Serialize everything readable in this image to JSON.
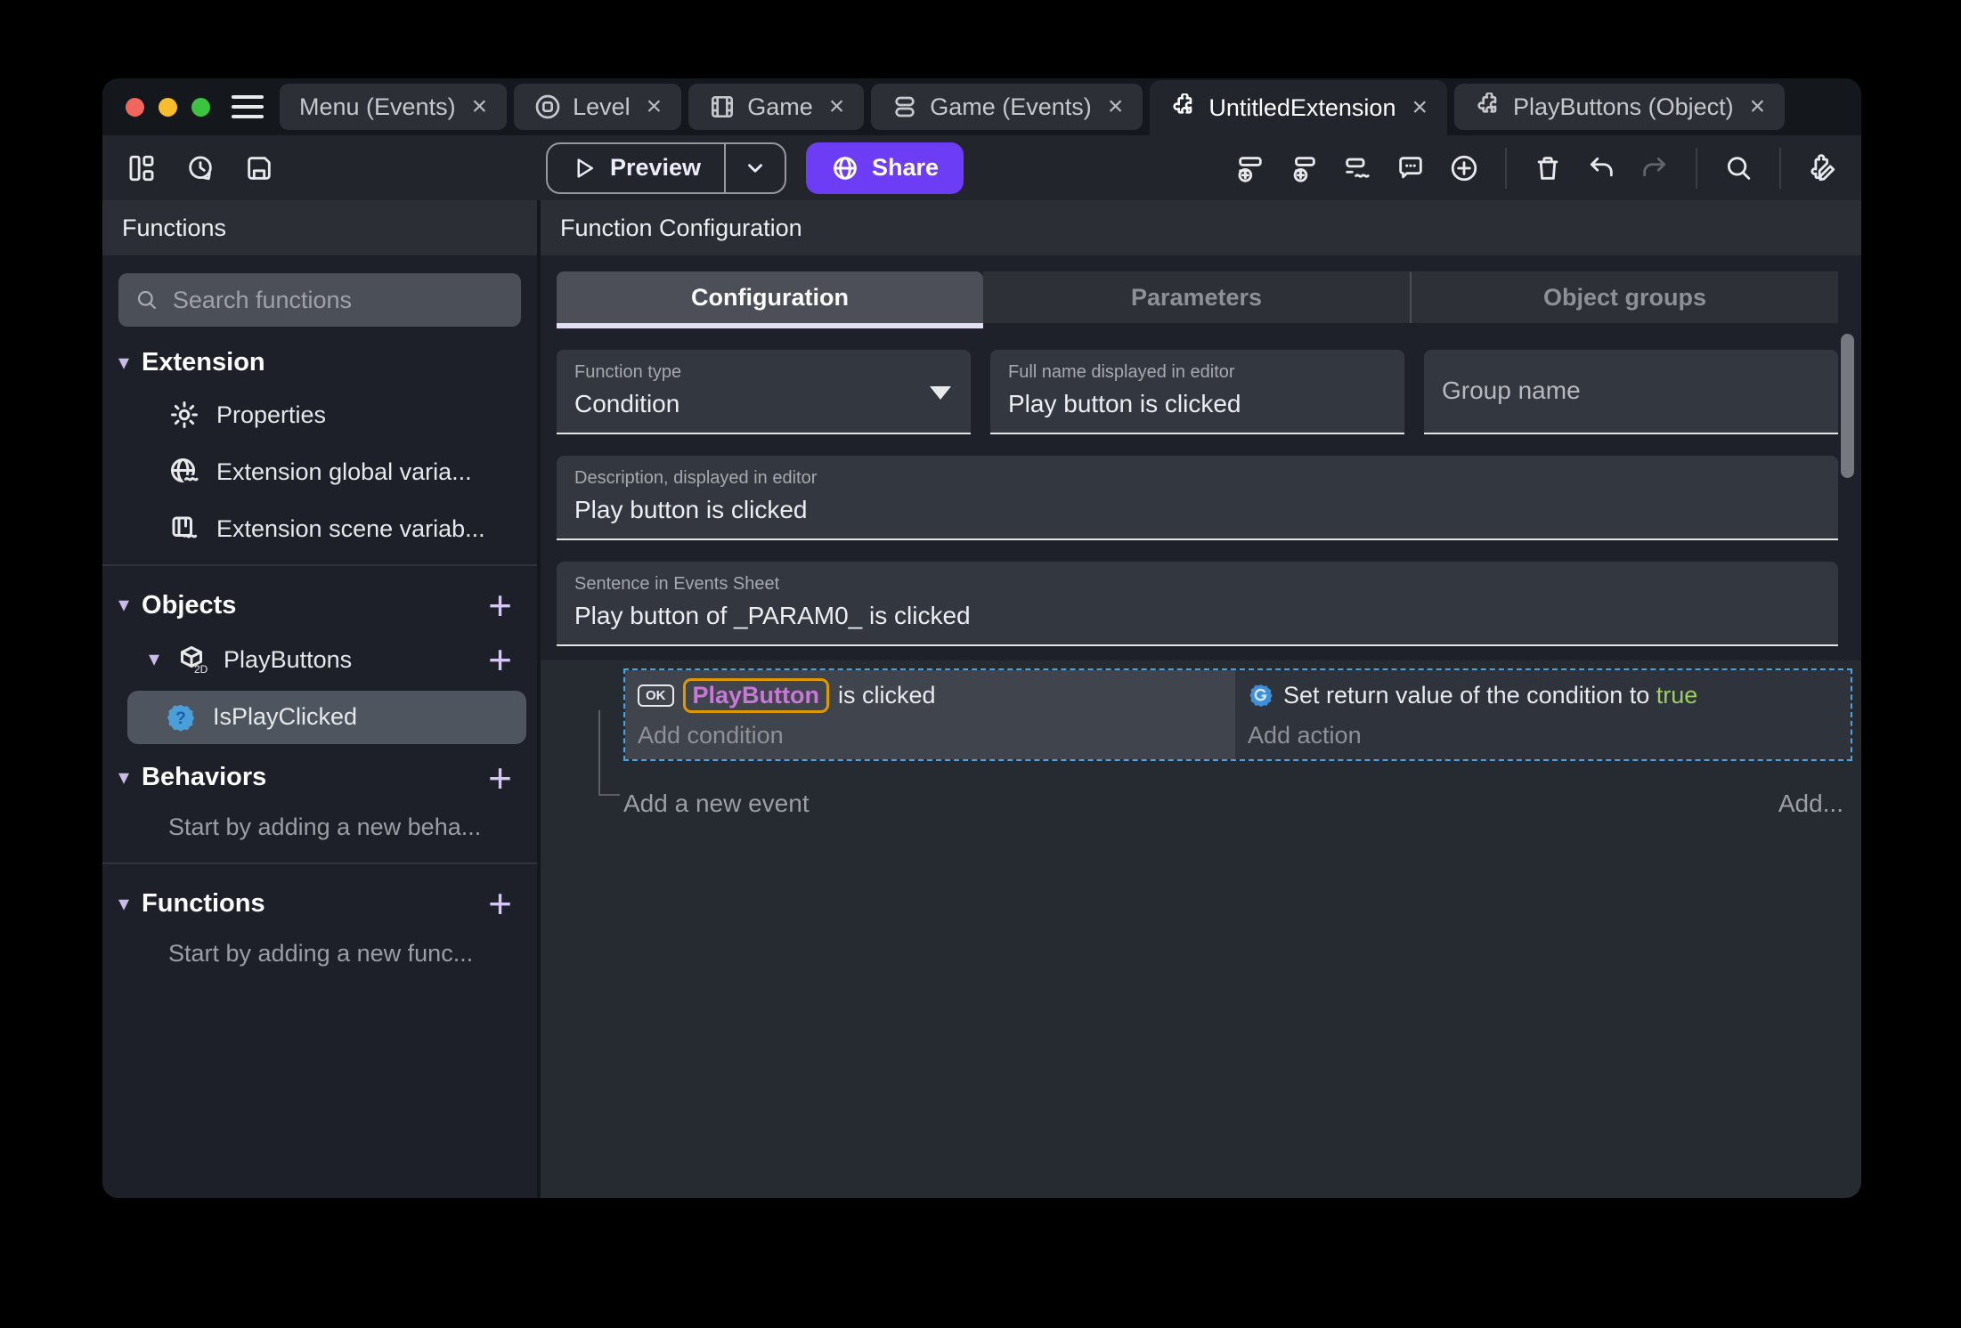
{
  "window": {
    "tabs": [
      {
        "label": "Menu (Events)",
        "close": "×"
      },
      {
        "label": "Level",
        "close": "×"
      },
      {
        "label": "Game",
        "close": "×"
      },
      {
        "label": "Game (Events)",
        "close": "×"
      },
      {
        "label": "UntitledExtension",
        "close": "×"
      },
      {
        "label": "PlayButtons (Object)",
        "close": "×"
      }
    ]
  },
  "toolbar": {
    "preview_label": "Preview",
    "share_label": "Share"
  },
  "sidebar": {
    "title": "Functions",
    "search_placeholder": "Search functions",
    "extension_header": "Extension",
    "items": {
      "properties": "Properties",
      "global_vars": "Extension global varia...",
      "scene_vars": "Extension scene variab..."
    },
    "objects_header": "Objects",
    "objects_plus": "+",
    "playbuttons": "PlayButtons",
    "playbuttons_plus": "+",
    "isplayclicked": "IsPlayClicked",
    "behaviors_header": "Behaviors",
    "behaviors_plus": "+",
    "behaviors_empty": "Start by adding a new beha...",
    "functions_header": "Functions",
    "functions_plus": "+",
    "functions_empty": "Start by adding a new func..."
  },
  "main": {
    "title": "Function Configuration",
    "tabs": [
      {
        "label": "Configuration"
      },
      {
        "label": "Parameters"
      },
      {
        "label": "Object groups"
      }
    ],
    "fields": {
      "function_type": {
        "label": "Function type",
        "value": "Condition"
      },
      "full_name": {
        "label": "Full name displayed in editor",
        "value": "Play button is clicked"
      },
      "group_name": {
        "placeholder": "Group name"
      },
      "description": {
        "label": "Description, displayed in editor",
        "value": "Play button is clicked"
      },
      "sentence": {
        "label": "Sentence in Events Sheet",
        "value": "Play button of _PARAM0_ is clicked"
      }
    },
    "events": {
      "condition_object_icon": "OK",
      "condition_object": "PlayButton",
      "condition_suffix": " is clicked",
      "add_condition": "Add condition",
      "action_prefix": "Set return value of the condition to ",
      "action_value": "true",
      "add_action": "Add action",
      "add_event": "Add a new event",
      "add_more": "Add..."
    }
  },
  "colors": {
    "accent_purple": "#6d3cf5",
    "chip_border_orange": "#df9900",
    "chip_text_purple": "#c978d8",
    "true_green": "#9ccc65",
    "selection_blue": "#4da3e0",
    "traffic_red": "#f2655c",
    "traffic_yellow": "#f7bd2e",
    "traffic_green": "#3bc440"
  }
}
